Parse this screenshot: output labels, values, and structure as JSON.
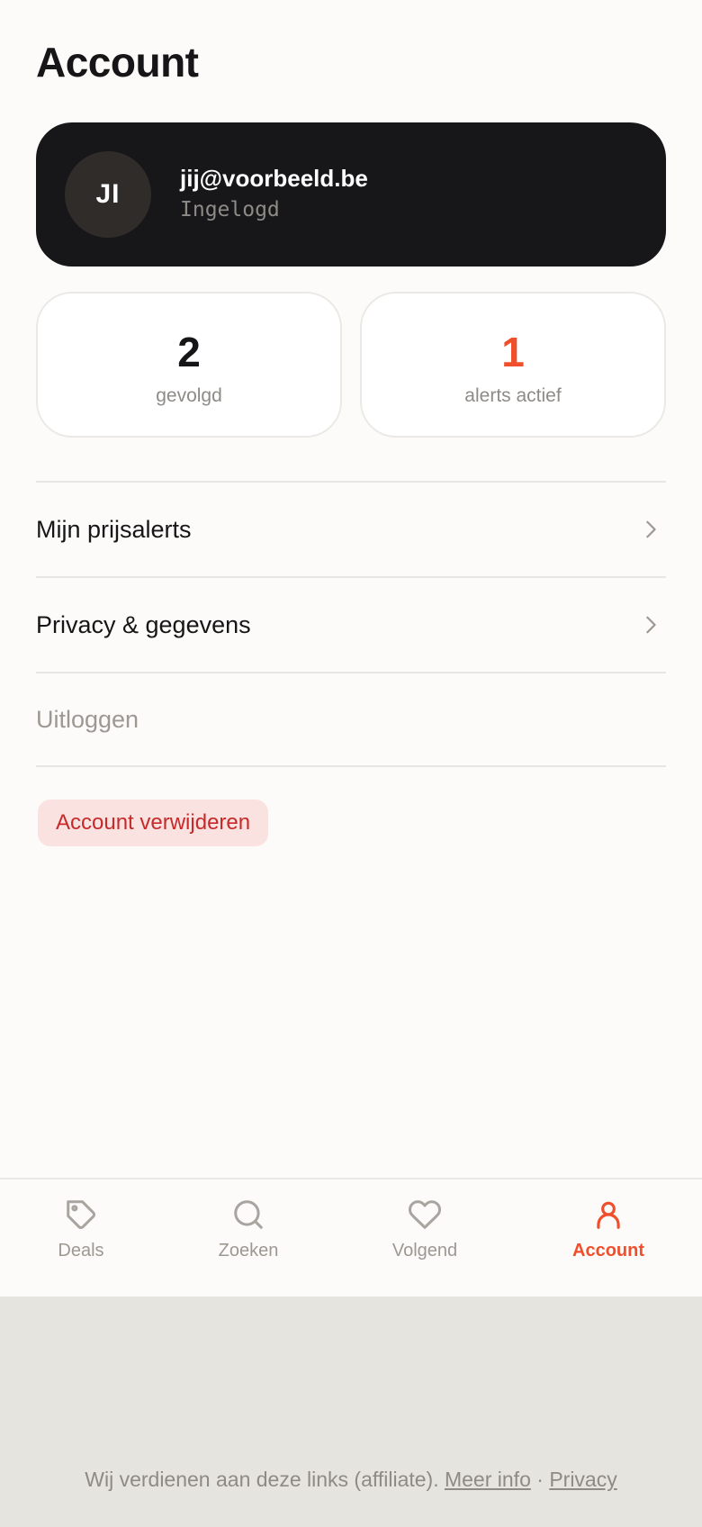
{
  "header": {
    "title": "Account"
  },
  "profile": {
    "initials": "JI",
    "email": "jij@voorbeeld.be",
    "status": "Ingelogd"
  },
  "stats": [
    {
      "value": "2",
      "label": "gevolgd"
    },
    {
      "value": "1",
      "label": "alerts actief"
    }
  ],
  "menu": {
    "alerts_label": "Mijn prijsalerts",
    "privacy_label": "Privacy & gegevens",
    "logout_label": "Uitloggen",
    "delete_label": "Account verwijderen"
  },
  "tabbar": {
    "items": [
      {
        "label": "Deals",
        "icon": "tag-icon"
      },
      {
        "label": "Zoeken",
        "icon": "search-icon"
      },
      {
        "label": "Volgend",
        "icon": "heart-icon"
      },
      {
        "label": "Account",
        "icon": "user-icon"
      }
    ],
    "active": "Account"
  },
  "footer": {
    "text": "Wij verdienen aan deze links (affiliate).",
    "more_info": "Meer info",
    "separator": "·",
    "privacy": "Privacy"
  },
  "colors": {
    "accent": "#ef4f2b",
    "card_dark": "#17171a",
    "danger_text": "#c62a2a",
    "danger_bg": "#fae2e0",
    "muted": "#9c9892"
  }
}
